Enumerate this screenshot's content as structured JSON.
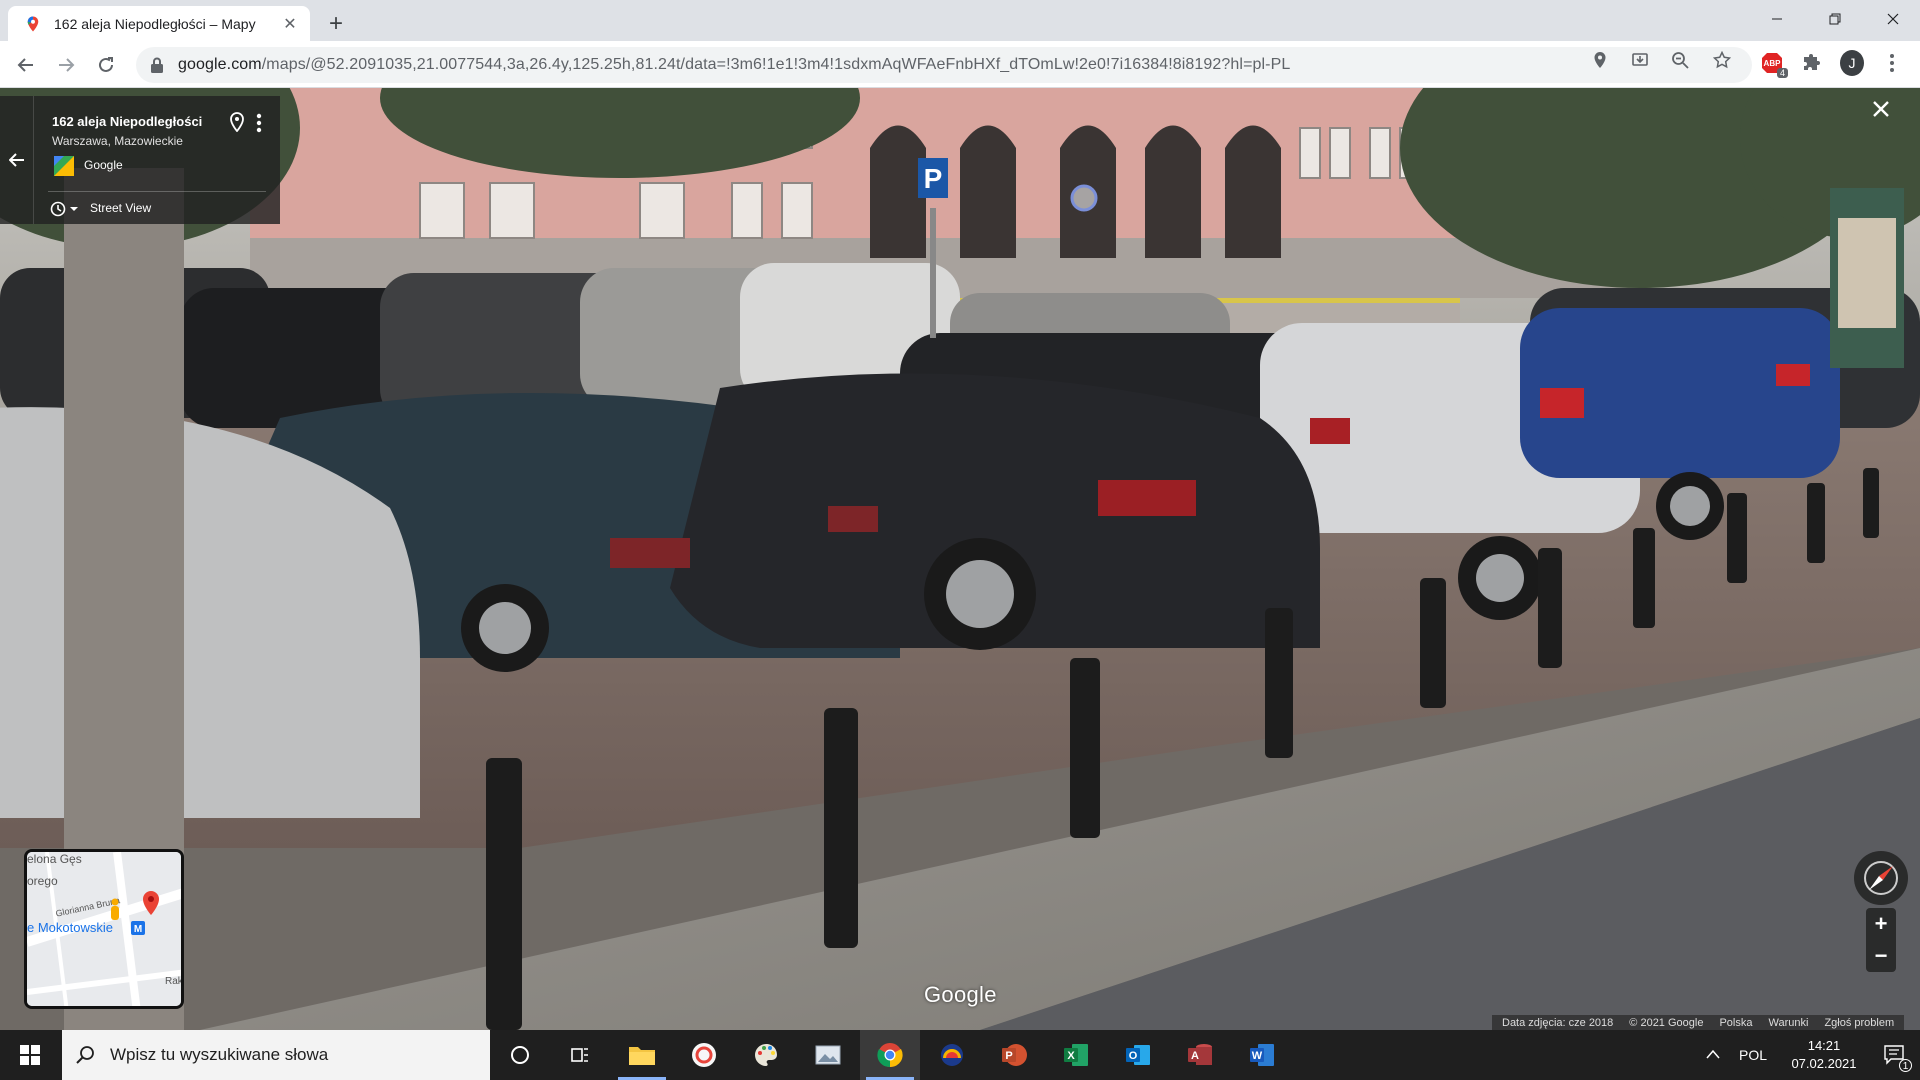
{
  "browser": {
    "tab_title": "162 aleja Niepodległości – Mapy",
    "url_host": "google.com",
    "url_path": "/maps/@52.2091035,21.0077544,3a,26.4y,125.25h,81.24t/data=!3m6!1e1!3m4!1sdxmAqWFAeFnbHXf_dTOmLw!2e0!7i16384!8i8192?hl=pl-PL",
    "abp_badge": "4",
    "profile_initial": "J"
  },
  "streetview": {
    "place_title": "162 aleja Niepodległości",
    "place_subtitle": "Warszawa, Mazowieckie",
    "provider": "Google",
    "mode_label": "Street View",
    "watermark": "Google",
    "minimap": {
      "labels": [
        "elona Gęs",
        "orego",
        "Glorianna Bruna",
        "e Mokotowskie",
        "Rak"
      ]
    },
    "attribution": [
      "Data zdjęcia: cze 2018",
      "© 2021 Google",
      "Polska",
      "Warunki",
      "Zgłoś problem"
    ]
  },
  "taskbar": {
    "search_placeholder": "Wpisz tu wyszukiwane słowa",
    "language": "POL",
    "time": "14:21",
    "date": "07.02.2021",
    "notification_count": "1"
  },
  "colors": {
    "chrome_frame": "#dee1e6",
    "taskbar": "#1f1f1f",
    "building": "#d9a59e",
    "maps_red": "#ea4335"
  }
}
